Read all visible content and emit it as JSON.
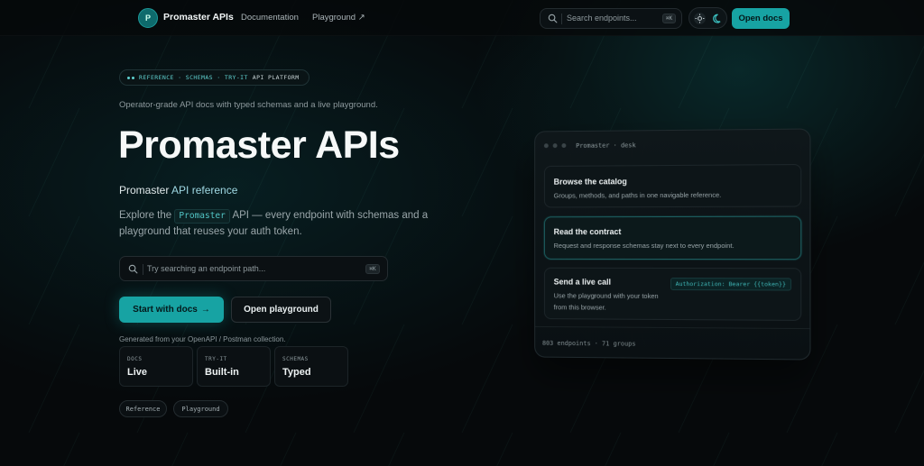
{
  "header": {
    "logo_letter": "P",
    "brand": "Promaster APIs",
    "nav": [
      "Documentation",
      "Playground ↗"
    ],
    "search_placeholder": "Search endpoints...",
    "search_shortcut": "⌘K",
    "open_docs_label": "Open docs"
  },
  "hero": {
    "eyebrow_tags": "REFERENCE · SCHEMAS · TRY-IT",
    "eyebrow_tail": "API PLATFORM",
    "tagline": "Operator-grade API docs with typed schemas and a live playground.",
    "title": "Promaster APIs",
    "subtitle_lead": "Promaster",
    "subtitle_accent": "API reference",
    "desc_before": "Explore the",
    "desc_code": "Promaster",
    "desc_after": "API — every endpoint with schemas and a playground that reuses your auth token.",
    "search_placeholder": "Try searching an endpoint path...",
    "search_shortcut": "⌘K",
    "start_label": "Start with docs",
    "start_arrow": "→",
    "playground_label": "Open playground",
    "generated": "Generated from your OpenAPI / Postman collection.",
    "stats": [
      {
        "key": "DOCS",
        "value": "Live"
      },
      {
        "key": "TRY-IT",
        "value": "Built-in"
      },
      {
        "key": "SCHEMAS",
        "value": "Typed"
      }
    ],
    "chips": [
      "Reference",
      "Playground"
    ]
  },
  "panel": {
    "title": "Promaster · desk",
    "cards": [
      {
        "heading": "Browse the catalog",
        "body": "Groups, methods, and paths in one navigable reference."
      },
      {
        "heading": "Read the contract",
        "body": "Request and response schemas stay next to every endpoint."
      },
      {
        "heading": "Send a live call",
        "body": "Use the playground with your token from this browser.",
        "code": "Authorization: Bearer {{token}}"
      }
    ],
    "footer": "803 endpoints · 71 groups"
  },
  "colors": {
    "accent": "#17a3a3",
    "background": "#06090b",
    "code": "#52c6c6"
  }
}
